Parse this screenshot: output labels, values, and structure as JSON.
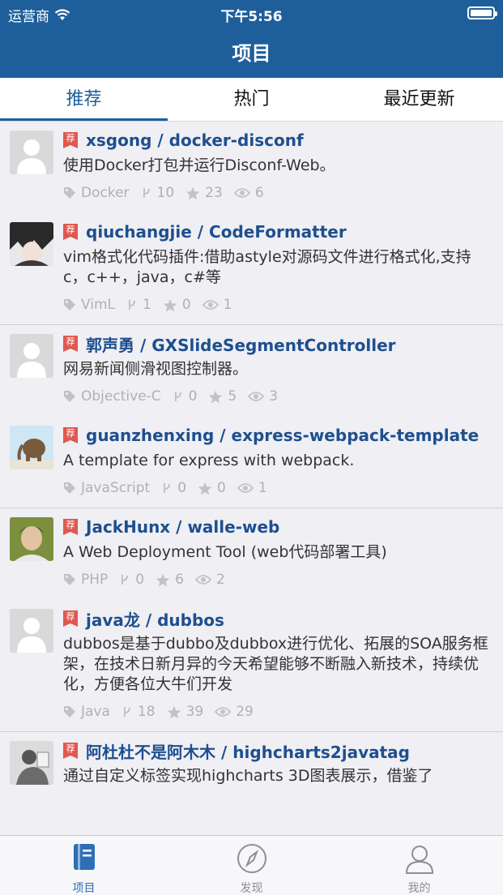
{
  "status": {
    "carrier": "运营商",
    "time": "下午5:56"
  },
  "nav": {
    "title": "项目"
  },
  "tabs": [
    {
      "label": "推荐",
      "active": true
    },
    {
      "label": "热门",
      "active": false
    },
    {
      "label": "最近更新",
      "active": false
    }
  ],
  "badge": "荐",
  "projects": [
    {
      "repo": "xsgong / docker-disconf",
      "desc": "使用Docker打包并运行Disconf-Web。",
      "lang": "Docker",
      "forks": "10",
      "stars": "23",
      "watch": "6",
      "avatar": "default-avatar"
    },
    {
      "repo": "qiuchangjie / CodeFormatter",
      "desc": "vim格式化代码插件:借助astyle对源码文件进行格式化,支持c，c++，java，c#等",
      "lang": "VimL",
      "forks": "1",
      "stars": "0",
      "watch": "1",
      "avatar": "anime-avatar"
    },
    {
      "repo": "郭声勇 / GXSlideSegmentController",
      "desc": "网易新闻侧滑视图控制器。",
      "lang": "Objective-C",
      "forks": "0",
      "stars": "5",
      "watch": "3",
      "avatar": "default-avatar"
    },
    {
      "repo": "guanzhenxing / express-webpack-template",
      "desc": "A template for express with webpack.",
      "lang": "JavaScript",
      "forks": "0",
      "stars": "0",
      "watch": "1",
      "avatar": "elephant-avatar"
    },
    {
      "repo": "JackHunx / walle-web",
      "desc": "A Web Deployment Tool (web代码部署工具)",
      "lang": "PHP",
      "forks": "0",
      "stars": "6",
      "watch": "2",
      "avatar": "photo-avatar"
    },
    {
      "repo": "java龙 / dubbos",
      "desc": "dubbos是基于dubbo及dubbox进行优化、拓展的SOA服务框架，在技术日新月异的今天希望能够不断融入新技术，持续优化，方便各位大牛们开发",
      "lang": "Java",
      "forks": "18",
      "stars": "39",
      "watch": "29",
      "avatar": "default-avatar"
    },
    {
      "repo": "阿杜杜不是阿木木 / highcharts2javatag",
      "desc": "通过自定义标签实现highcharts 3D图表展示，借鉴了",
      "lang": "",
      "forks": "",
      "stars": "",
      "watch": "",
      "avatar": "sketch-avatar"
    }
  ],
  "tabbar": [
    {
      "label": "项目",
      "icon": "book-icon",
      "active": true
    },
    {
      "label": "发现",
      "icon": "compass-icon",
      "active": false
    },
    {
      "label": "我的",
      "icon": "person-icon",
      "active": false
    }
  ],
  "colors": {
    "nav": "#1e5f9b",
    "link": "#1e4f8f",
    "badge": "#e0584f",
    "meta": "#b0b0b5",
    "tab_active": "#2d6fb5"
  }
}
